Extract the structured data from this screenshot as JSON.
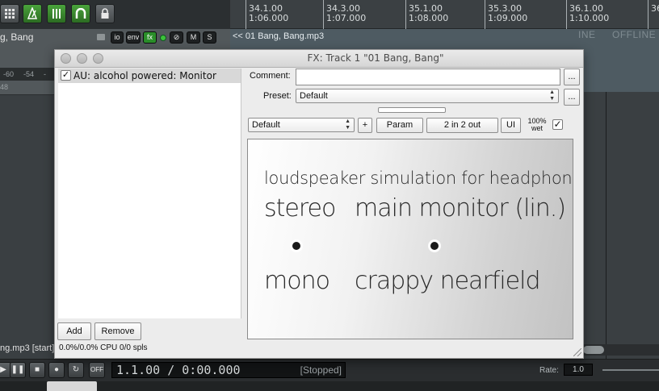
{
  "daw": {
    "toolbar": {
      "icons": [
        "grid-icon",
        "metronome-icon",
        "mixer-icon",
        "snap-icon",
        "lock-icon"
      ]
    },
    "ruler": {
      "marks": [
        {
          "bar": "34.1.00",
          "time": "1:06.000"
        },
        {
          "bar": "34.3.00",
          "time": "1:07.000"
        },
        {
          "bar": "35.1.00",
          "time": "1:08.000"
        },
        {
          "bar": "35.3.00",
          "time": "1:09.000"
        },
        {
          "bar": "36.1.00",
          "time": "1:10.000"
        },
        {
          "bar": "36",
          "time": ""
        }
      ]
    },
    "track": {
      "name": "g, Bang",
      "buttons": {
        "io": "io",
        "env": "env",
        "fx": "fx",
        "mute": "M",
        "solo": "S"
      },
      "meter_ticks": [
        "-60",
        "-54",
        "-48"
      ],
      "status": "ng.mp3 [start]"
    },
    "item": {
      "label": "<< 01 Bang, Bang.mp3",
      "offline": [
        "INE",
        "OFFLINE"
      ]
    },
    "transport": {
      "time": "1.1.00 / 0:00.000",
      "state": "[Stopped]",
      "rate_label": "Rate:",
      "rate_value": "1.0",
      "off_label": "OFF"
    }
  },
  "fx_window": {
    "title": "FX: Track 1 \"01 Bang, Bang\"",
    "chain": [
      {
        "name": "AU: alcohol powered: Monitor",
        "enabled": true
      }
    ],
    "add_label": "Add",
    "remove_label": "Remove",
    "cpu": "0.0%/0.0% CPU 0/0 spls",
    "comment_label": "Comment:",
    "comment_value": "",
    "preset_label": "Preset:",
    "preset_value": "Default",
    "ellipsis": "...",
    "preset2_value": "Default",
    "plus_label": "+",
    "param_label": "Param",
    "io_label": "2 in 2 out",
    "ui_label": "UI",
    "wet_pct": "100%",
    "wet_label": "wet",
    "plugin": {
      "heading": "loudspeaker simulation for headphones",
      "options": [
        "stereo",
        "main monitor (lin.)",
        "mono",
        "crappy nearfield"
      ]
    }
  }
}
